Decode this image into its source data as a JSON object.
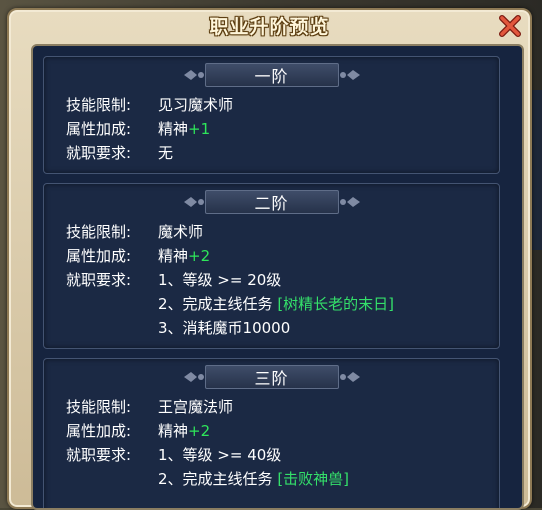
{
  "title": "职业升阶预览",
  "colors": {
    "accent_green": "#2ee65a",
    "panel": "#16243f",
    "frame": "#d8c9a8"
  },
  "tiers": [
    {
      "name": "一阶",
      "skill_label": "技能限制:",
      "skill_value": "见习魔术师",
      "attr_label": "属性加成:",
      "attr_name": "精神",
      "attr_bonus": "+1",
      "req_label": "就职要求:",
      "req_plain": "无"
    },
    {
      "name": "二阶",
      "skill_label": "技能限制:",
      "skill_value": "魔术师",
      "attr_label": "属性加成:",
      "attr_name": "精神",
      "attr_bonus": "+2",
      "req_label": "就职要求:",
      "req1": "1、等级 >= 20级",
      "req2": "2、完成主线任务",
      "req2_quest": "[树精长老的末日]",
      "req3": "3、消耗魔币10000"
    },
    {
      "name": "三阶",
      "skill_label": "技能限制:",
      "skill_value": "王宫魔法师",
      "attr_label": "属性加成:",
      "attr_name": "精神",
      "attr_bonus": "+2",
      "req_label": "就职要求:",
      "req1": "1、等级 >= 40级",
      "req2": "2、完成主线任务",
      "req2_quest": "[击败神兽]"
    }
  ]
}
